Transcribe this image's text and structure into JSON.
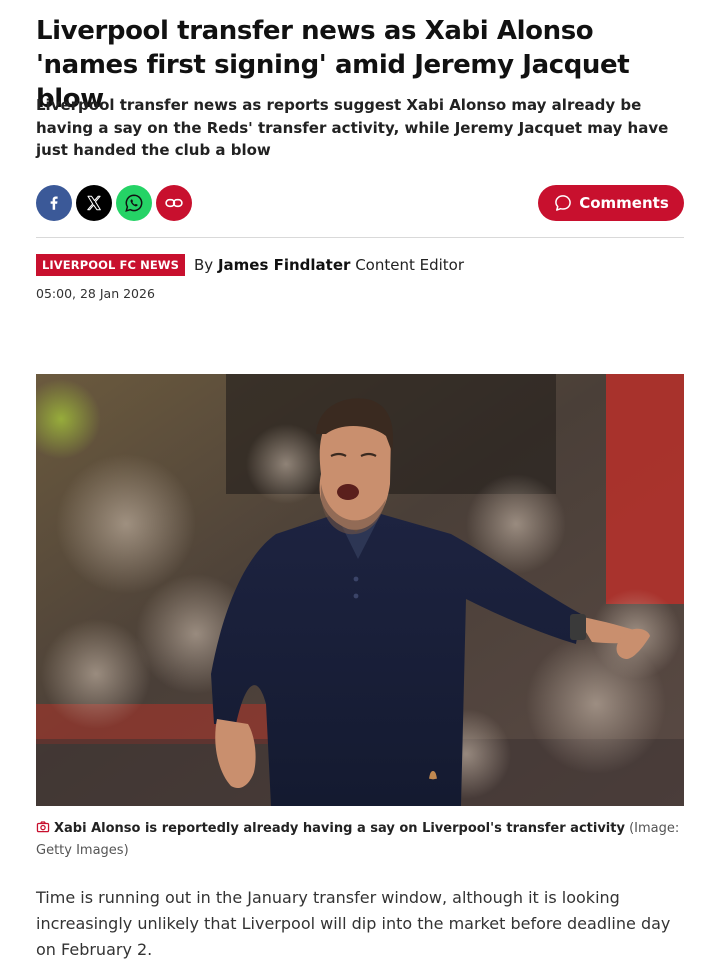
{
  "article": {
    "headline": "Liverpool transfer news as Xabi Alonso 'names first signing' amid Jeremy Jacquet blow",
    "standfirst": "Liverpool transfer news as reports suggest Xabi Alonso may already be having a say on the Reds' transfer activity, while Jeremy Jacquet may have just handed the club a blow",
    "section_tag": "LIVERPOOL FC NEWS",
    "byline_prefix": "By",
    "author": "James Findlater",
    "author_role": "Content Editor",
    "timestamp": "05:00, 28 Jan 2026",
    "caption_main": "Xabi Alonso is reportedly already having a say on Liverpool's transfer activity",
    "caption_credit": "(Image: Getty Images)",
    "body": "Time is running out in the January transfer window, although it is looking increasingly unlikely that Liverpool will dip into the market before deadline day on February 2."
  },
  "share": {
    "buttons": [
      {
        "icon": "facebook-icon",
        "color": "#3b5998"
      },
      {
        "icon": "x-icon",
        "color": "#000000"
      },
      {
        "icon": "whatsapp-icon",
        "color": "#25d366"
      },
      {
        "icon": "link-icon",
        "color": "#c8102e"
      }
    ],
    "comments_label": "Comments"
  },
  "theme": {
    "accent": "#c8102e"
  }
}
